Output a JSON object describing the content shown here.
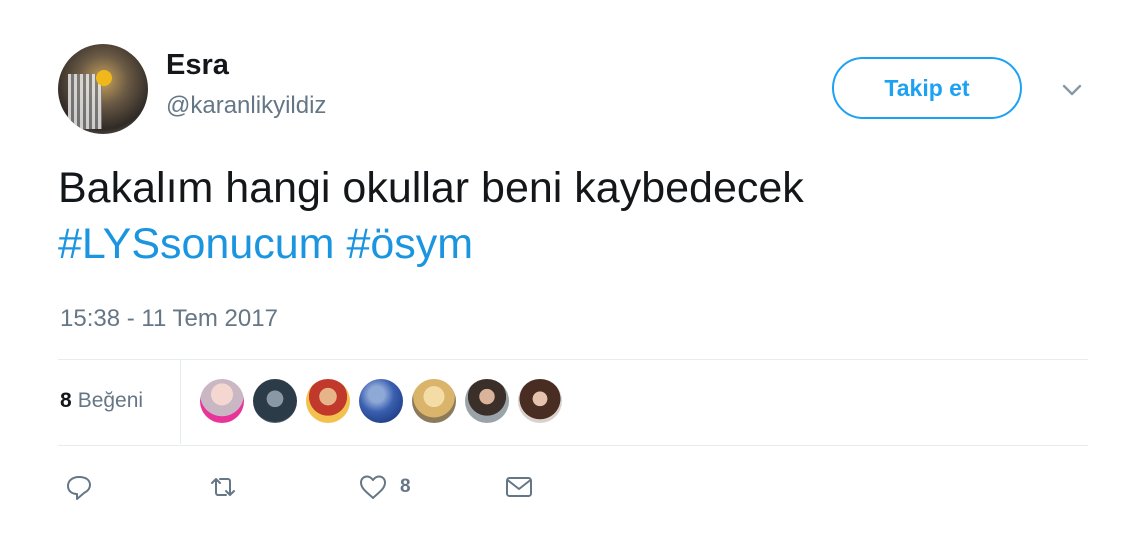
{
  "user": {
    "display_name": "Esra",
    "handle": "@karanlikyildiz"
  },
  "follow_button": {
    "label": "Takip et"
  },
  "tweet": {
    "text_line1": "Bakalım hangi okullar beni kaybedecek",
    "hashtags": [
      "#LYSsonucum",
      "#ösym"
    ],
    "timestamp": "15:38 - 11 Tem 2017"
  },
  "stats": {
    "likes_count": "8",
    "likes_label": "Beğeni"
  },
  "likers_count": 7,
  "actions": {
    "reply_icon": "reply-icon",
    "retweet_icon": "retweet-icon",
    "like_icon": "heart-icon",
    "like_count": "8",
    "dm_icon": "envelope-icon"
  },
  "colors": {
    "accent": "#1da1f2",
    "hashtag": "#1b95e0",
    "muted": "#657786"
  }
}
